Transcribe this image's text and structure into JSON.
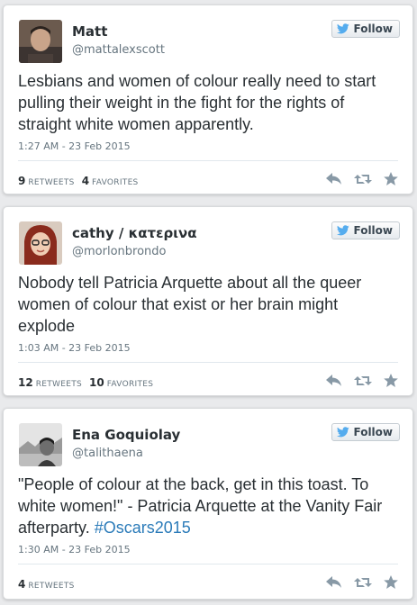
{
  "tweets": [
    {
      "name": "Matt",
      "handle": "@mattalexscott",
      "follow_label": "Follow",
      "text": "Lesbians and women of colour really need to start pulling their weight in the fight for the rights of straight white women apparently.",
      "time": "1:27 AM - 23 Feb 2015",
      "retweets_count": "9",
      "retweets_label": "RETWEETS",
      "favorites_count": "4",
      "favorites_label": "FAVORITES"
    },
    {
      "name": "cathy / κατερινα",
      "handle": "@morlonbrondo",
      "follow_label": "Follow",
      "text": "Nobody tell Patricia Arquette about all the queer women of colour that exist or her brain might explode",
      "time": "1:03 AM - 23 Feb 2015",
      "retweets_count": "12",
      "retweets_label": "RETWEETS",
      "favorites_count": "10",
      "favorites_label": "FAVORITES"
    },
    {
      "name": "Ena Goquiolay",
      "handle": "@talithaena",
      "follow_label": "Follow",
      "text": "\"People of colour at the back, get in this toast. To white women!\" - Patricia Arquette at the Vanity Fair afterparty. ",
      "hashtag": "#Oscars2015",
      "time": "1:30 AM - 23 Feb 2015",
      "retweets_count": "4",
      "retweets_label": "RETWEETS"
    }
  ],
  "colors": {
    "background": "#e9eaec",
    "card": "#ffffff",
    "twitter_blue": "#55acee",
    "hashtag_link": "#2b7bb9",
    "muted_text": "#66757f",
    "action_icon": "#8899a6"
  },
  "icons": {
    "follow": "twitter-bird-icon",
    "reply": "reply-icon",
    "retweet": "retweet-icon",
    "favorite": "star-icon"
  }
}
